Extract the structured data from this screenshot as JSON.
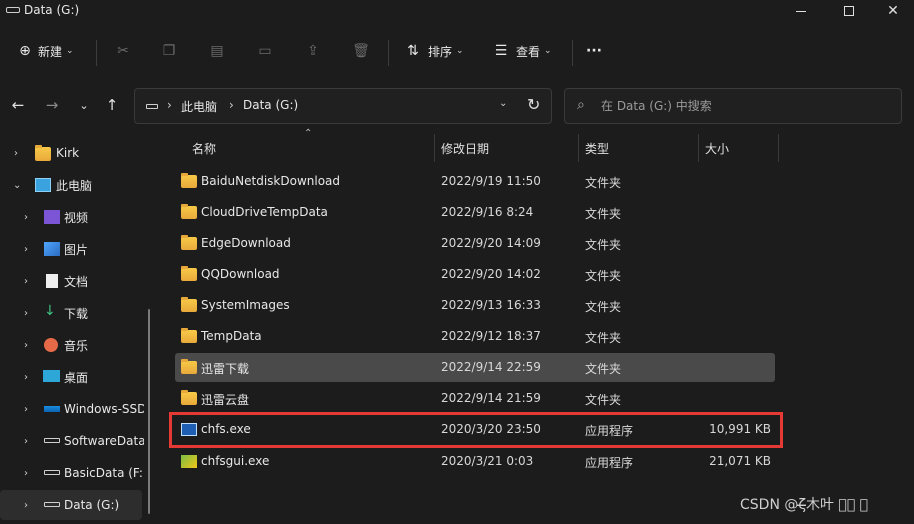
{
  "window": {
    "title": "Data (G:)",
    "minimize": "─",
    "maximize": "☐",
    "close": "✕"
  },
  "toolbar": {
    "new_label": "新建",
    "sort_label": "排序",
    "view_label": "查看",
    "more_label": "···"
  },
  "address": {
    "crumbs": [
      "此电脑",
      "Data (G:)"
    ],
    "search_placeholder": "在 Data (G:) 中搜索"
  },
  "sidebar": {
    "items": [
      {
        "label": "Kirk",
        "icon": "folder-icon",
        "expanded": false
      },
      {
        "label": "此电脑",
        "icon": "computer-icon",
        "expanded": true
      },
      {
        "label": "视频",
        "icon": "video-icon",
        "expanded": false
      },
      {
        "label": "图片",
        "icon": "pictures-icon",
        "expanded": false
      },
      {
        "label": "文档",
        "icon": "documents-icon",
        "expanded": false
      },
      {
        "label": "下载",
        "icon": "downloads-icon",
        "expanded": false
      },
      {
        "label": "音乐",
        "icon": "music-icon",
        "expanded": false
      },
      {
        "label": "桌面",
        "icon": "desktop-icon",
        "expanded": false
      },
      {
        "label": "Windows-SSD",
        "icon": "drive-icon",
        "expanded": false
      },
      {
        "label": "SoftwareData",
        "icon": "drive-icon",
        "expanded": false
      },
      {
        "label": "BasicData (F:)",
        "icon": "drive-icon",
        "expanded": false
      },
      {
        "label": "Data (G:)",
        "icon": "drive-icon",
        "expanded": false,
        "selected": true
      }
    ]
  },
  "columns": {
    "name": "名称",
    "date": "修改日期",
    "type": "类型",
    "size": "大小"
  },
  "files": [
    {
      "name": "BaiduNetdiskDownload",
      "date": "2022/9/19 11:50",
      "type": "文件夹",
      "size": "",
      "icon": "folder-icon"
    },
    {
      "name": "CloudDriveTempData",
      "date": "2022/9/16 8:24",
      "type": "文件夹",
      "size": "",
      "icon": "folder-icon"
    },
    {
      "name": "EdgeDownload",
      "date": "2022/9/20 14:09",
      "type": "文件夹",
      "size": "",
      "icon": "folder-icon"
    },
    {
      "name": "QQDownload",
      "date": "2022/9/20 14:02",
      "type": "文件夹",
      "size": "",
      "icon": "folder-icon"
    },
    {
      "name": "SystemImages",
      "date": "2022/9/13 16:33",
      "type": "文件夹",
      "size": "",
      "icon": "folder-icon"
    },
    {
      "name": "TempData",
      "date": "2022/9/12 18:37",
      "type": "文件夹",
      "size": "",
      "icon": "folder-icon"
    },
    {
      "name": "迅雷下载",
      "date": "2022/9/14 22:59",
      "type": "文件夹",
      "size": "",
      "icon": "folder-icon",
      "selected": true
    },
    {
      "name": "迅雷云盘",
      "date": "2022/9/14 21:59",
      "type": "文件夹",
      "size": "",
      "icon": "folder-icon"
    },
    {
      "name": "chfs.exe",
      "date": "2020/3/20 23:50",
      "type": "应用程序",
      "size": "10,991 KB",
      "icon": "exe-icon"
    },
    {
      "name": "chfsgui.exe",
      "date": "2020/3/21 0:03",
      "type": "应用程序",
      "size": "21,071 KB",
      "icon": "exe-gui-icon"
    }
  ],
  "watermark": "CSDN @ζ̶̶̶̶̶木叶 ⃢⃢ ⃢",
  "colors": {
    "highlight": "#e53935",
    "background": "#1c1c1c",
    "selected_row": "#4a4a4a"
  }
}
